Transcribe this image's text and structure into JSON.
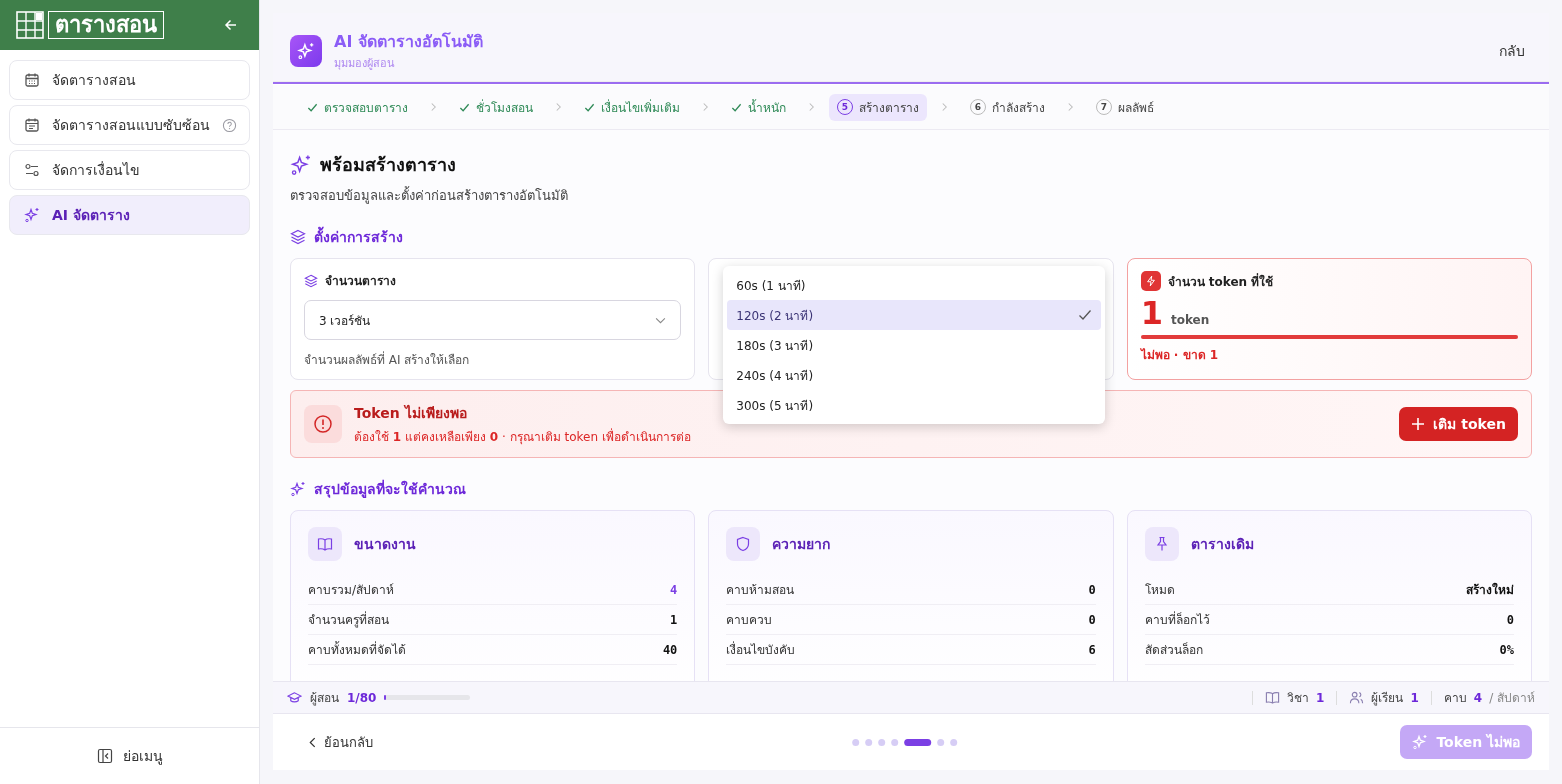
{
  "sidebar": {
    "logo": "ตารางสอน",
    "items": [
      {
        "label": "จัดตารางสอน",
        "help": false,
        "selected": false
      },
      {
        "label": "จัดตารางสอนแบบซับซ้อน",
        "help": true,
        "selected": false
      },
      {
        "label": "จัดการเงื่อนไข",
        "help": false,
        "selected": false
      },
      {
        "label": "AI จัดตาราง",
        "help": false,
        "selected": true
      }
    ],
    "collapse": "ย่อเมนู"
  },
  "header": {
    "title": "AI จัดตารางอัตโนมัติ",
    "subtitle": "มุมมองผู้สอน",
    "back": "กลับ"
  },
  "steps": [
    {
      "label": "ตรวจสอบตาราง",
      "done": true,
      "selected": false
    },
    {
      "label": "ชั่วโมงสอน",
      "done": true,
      "selected": false
    },
    {
      "label": "เงื่อนไขเพิ่มเติม",
      "done": true,
      "selected": false
    },
    {
      "label": "น้ำหนัก",
      "done": true,
      "selected": false
    },
    {
      "number": "5",
      "label": "สร้างตาราง",
      "done": false,
      "selected": true
    },
    {
      "number": "6",
      "label": "กำลังสร้าง",
      "done": false,
      "selected": false
    },
    {
      "number": "7",
      "label": "ผลลัพธ์",
      "done": false,
      "selected": false
    }
  ],
  "intro": {
    "title": "พร้อมสร้างตาราง",
    "description": "ตรวจสอบข้อมูลและตั้งค่าก่อนสร้างตารางอัตโนมัติ"
  },
  "settings": {
    "heading": "ตั้งค่าการสร้าง",
    "versions": {
      "label": "จำนวนตาราง",
      "value": "3 เวอร์ชัน",
      "hint": "จำนวนผลลัพธ์ที่ AI สร้างให้เลือก"
    },
    "time_options": [
      {
        "label": "60s (1 นาที)",
        "selected": false
      },
      {
        "label": "120s (2 นาที)",
        "selected": true
      },
      {
        "label": "180s (3 นาที)",
        "selected": false
      },
      {
        "label": "240s (4 นาที)",
        "selected": false
      },
      {
        "label": "300s (5 นาที)",
        "selected": false
      }
    ],
    "token": {
      "label": "จำนวน token ที่ใช้",
      "amount": "1",
      "unit": "token",
      "level": 1,
      "status": "ไม่พอ · ขาด 1"
    }
  },
  "alert": {
    "title": "Token ไม่เพียงพอ",
    "message": "ต้องใช้ **1** แต่คงเหลือเพียง **0** · กรุณาเติม token เพื่อดำเนินการต่อ",
    "action": "เติม token"
  },
  "summary": {
    "heading": "สรุปข้อมูลที่จะใช้คำนวณ",
    "cards": [
      {
        "title": "ขนาดงาน",
        "rows": [
          {
            "label": "คาบรวม/สัปดาห์",
            "value": "4",
            "accent": true
          },
          {
            "label": "จำนวนครูที่สอน",
            "value": "1",
            "accent": false
          },
          {
            "label": "คาบทั้งหมดที่จัดได้",
            "value": "40",
            "accent": false
          }
        ]
      },
      {
        "title": "ความยาก",
        "rows": [
          {
            "label": "คาบห้ามสอน",
            "value": "0",
            "accent": false
          },
          {
            "label": "คาบควบ",
            "value": "0",
            "accent": false
          },
          {
            "label": "เงื่อนไขบังคับ",
            "value": "6",
            "accent": false
          }
        ]
      },
      {
        "title": "ตารางเดิม",
        "rows": [
          {
            "label": "โหมด",
            "value": "สร้างใหม่",
            "accent": false
          },
          {
            "label": "คาบที่ล็อกไว้",
            "value": "0",
            "accent": false
          },
          {
            "label": "สัดส่วนล็อก",
            "value": "0%",
            "accent": false
          }
        ]
      }
    ]
  },
  "status_bar": {
    "label": "ผู้สอน",
    "count": "1/80",
    "level": 0.0125,
    "stats": [
      {
        "label": "วิชา",
        "value": "1"
      },
      {
        "label": "ผู้เรียน",
        "value": "1"
      },
      {
        "label": "คาบ",
        "value": "4",
        "suffix": "/ สัปดาห์"
      }
    ]
  },
  "footer": {
    "back": "ย้อนกลับ",
    "pages": [
      {
        "selected": false
      },
      {
        "selected": false
      },
      {
        "selected": false
      },
      {
        "selected": false
      },
      {
        "selected": true
      },
      {
        "selected": false
      },
      {
        "selected": false
      }
    ],
    "submit": "Token ไม่พอ",
    "submit_disabled": true
  }
}
